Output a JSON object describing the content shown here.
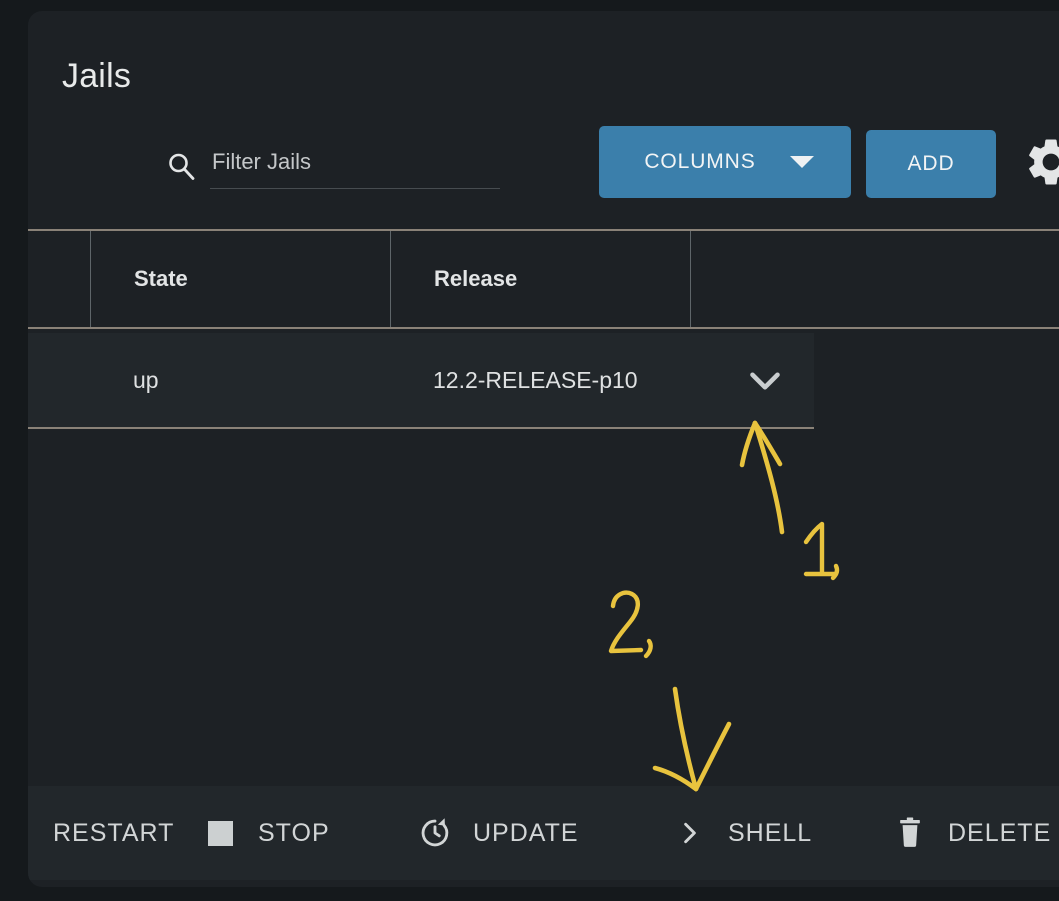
{
  "page": {
    "title": "Jails",
    "background_color": "#15191c",
    "card_color": "#1d2125",
    "accent_color": "#3b7fab",
    "annotation_color": "#e8c33e"
  },
  "toolbar": {
    "search": {
      "icon": "search-icon",
      "placeholder": "Filter Jails",
      "value": ""
    },
    "columns_button": {
      "label": "COLUMNS",
      "icon": "chevron-down-icon"
    },
    "add_button": {
      "label": "ADD"
    },
    "settings_button": {
      "icon": "gear-icon"
    }
  },
  "table": {
    "columns": [
      {
        "key": "state",
        "label": "State"
      },
      {
        "key": "release",
        "label": "Release"
      },
      {
        "key": "actions",
        "label": ""
      }
    ],
    "rows": [
      {
        "state": "up",
        "release": "12.2-RELEASE-p10",
        "expand_icon": "chevron-down-icon"
      }
    ]
  },
  "action_bar": {
    "actions": [
      {
        "label": "RESTART",
        "icon": "restart-icon"
      },
      {
        "label": "STOP",
        "icon": "stop-square-icon"
      },
      {
        "label": "UPDATE",
        "icon": "update-clock-icon"
      },
      {
        "label": "SHELL",
        "icon": "chevron-right-icon"
      },
      {
        "label": "DELETE",
        "icon": "trash-icon"
      }
    ]
  },
  "annotations": {
    "marks": [
      {
        "label": "1.",
        "points_to": "row-expand-chevron"
      },
      {
        "label": "2.",
        "points_to": "shell-action"
      }
    ]
  }
}
